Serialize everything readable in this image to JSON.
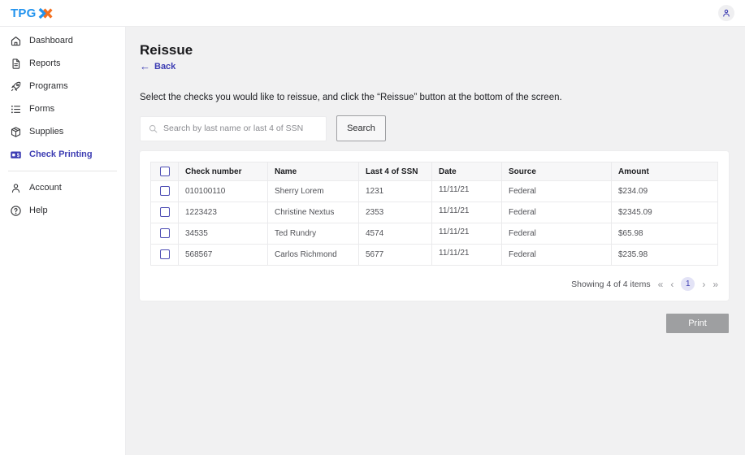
{
  "topbar": {
    "logo_text": "TPG",
    "avatar_icon": "user-icon"
  },
  "sidebar": {
    "items": [
      {
        "label": "Dashboard",
        "icon": "home-icon",
        "active": false
      },
      {
        "label": "Reports",
        "icon": "report-icon",
        "active": false
      },
      {
        "label": "Programs",
        "icon": "rocket-icon",
        "active": false
      },
      {
        "label": "Forms",
        "icon": "list-icon",
        "active": false
      },
      {
        "label": "Supplies",
        "icon": "package-icon",
        "active": false
      },
      {
        "label": "Check Printing",
        "icon": "check-icon",
        "active": true
      }
    ],
    "footer_items": [
      {
        "label": "Account",
        "icon": "person-icon",
        "active": false
      },
      {
        "label": "Help",
        "icon": "question-icon",
        "active": false
      }
    ]
  },
  "main": {
    "title": "Reissue",
    "back_arrow": "←",
    "back_label": "Back",
    "instruction": "Select the checks you would like to reissue, and click the “Reissue” button at the bottom of the screen.",
    "search": {
      "placeholder": "Search by last name or last 4 of SSN",
      "button_label": "Search"
    },
    "table": {
      "columns": [
        "Check number",
        "Name",
        "Last 4 of SSN",
        "Date",
        "Source",
        "Amount"
      ],
      "rows": [
        {
          "check_number": "010100110",
          "name": "Sherry Lorem",
          "ssn_last4": "1231",
          "date": "11/11/21",
          "source": "Federal",
          "amount": "$234.09",
          "checked": false
        },
        {
          "check_number": "1223423",
          "name": "Christine Nextus",
          "ssn_last4": "2353",
          "date": "11/11/21",
          "source": "Federal",
          "amount": "$2345.09",
          "checked": false
        },
        {
          "check_number": "34535",
          "name": "Ted Rundry",
          "ssn_last4": "4574",
          "date": "11/11/21",
          "source": "Federal",
          "amount": "$65.98",
          "checked": false
        },
        {
          "check_number": "568567",
          "name": "Carlos Richmond",
          "ssn_last4": "5677",
          "date": "11/11/21",
          "source": "Federal",
          "amount": "$235.98",
          "checked": false
        }
      ]
    },
    "pagination": {
      "summary": "Showing 4 of 4 items",
      "first": "«",
      "prev": "‹",
      "page": "1",
      "next": "›",
      "last": "»"
    },
    "print_button_label": "Print"
  },
  "colors": {
    "accent_indigo": "#3d3db3",
    "brand_blue": "#2293ee",
    "brand_orange": "#f4701f",
    "main_background": "#f1f1f2",
    "table_header_bg": "#f7f7f8",
    "print_button_bg": "#9e9fa1",
    "page_badge_bg": "#e3e3f6"
  }
}
